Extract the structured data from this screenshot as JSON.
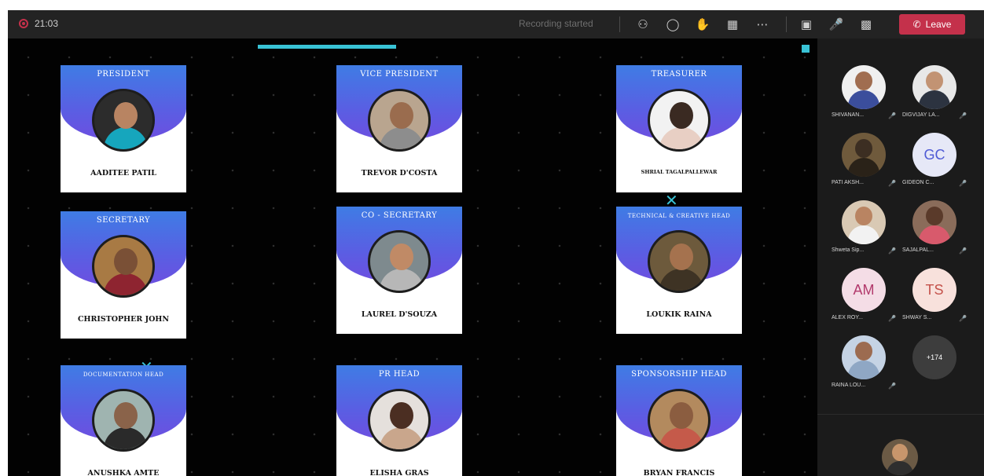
{
  "toolbar": {
    "timer": "21:03",
    "status": "Recording started",
    "leave_label": "Leave",
    "accent": "#c4314b"
  },
  "stage": {
    "accent": "#39c3d6",
    "cards": [
      {
        "role": "PRESIDENT",
        "name": "AADITEE PATIL"
      },
      {
        "role": "VICE PRESIDENT",
        "name": "TREVOR D'COSTA"
      },
      {
        "role": "TREASURER",
        "name": "SHRIAL TAGALPALLEWAR"
      },
      {
        "role": "SECRETARY",
        "name": "CHRISTOPHER JOHN"
      },
      {
        "role": "CO - SECRETARY",
        "name": "LAUREL D'SOUZA"
      },
      {
        "role": "TECHNICAL & CREATIVE HEAD",
        "name": "LOUKIK RAINA"
      },
      {
        "role": "DOCUMENTATION HEAD",
        "name": "ANUSHKA AMTE"
      },
      {
        "role": "PR HEAD",
        "name": "ELISHA GRAS"
      },
      {
        "role": "SPONSORSHIP HEAD",
        "name": "BRYAN FRANCIS"
      }
    ]
  },
  "participants": [
    {
      "name": "SHIVANAN...",
      "initials": ""
    },
    {
      "name": "DIGVIJAY LA...",
      "initials": ""
    },
    {
      "name": "PATI AKSH...",
      "initials": ""
    },
    {
      "name": "GIDEON C...",
      "initials": "GC"
    },
    {
      "name": "Shweta Sip...",
      "initials": ""
    },
    {
      "name": "SAJALPAL...",
      "initials": ""
    },
    {
      "name": "ALEX ROY...",
      "initials": "AM"
    },
    {
      "name": "SHWAY S...",
      "initials": "TS"
    },
    {
      "name": "RAINA LOU...",
      "initials": ""
    }
  ],
  "more_participants": "+174"
}
